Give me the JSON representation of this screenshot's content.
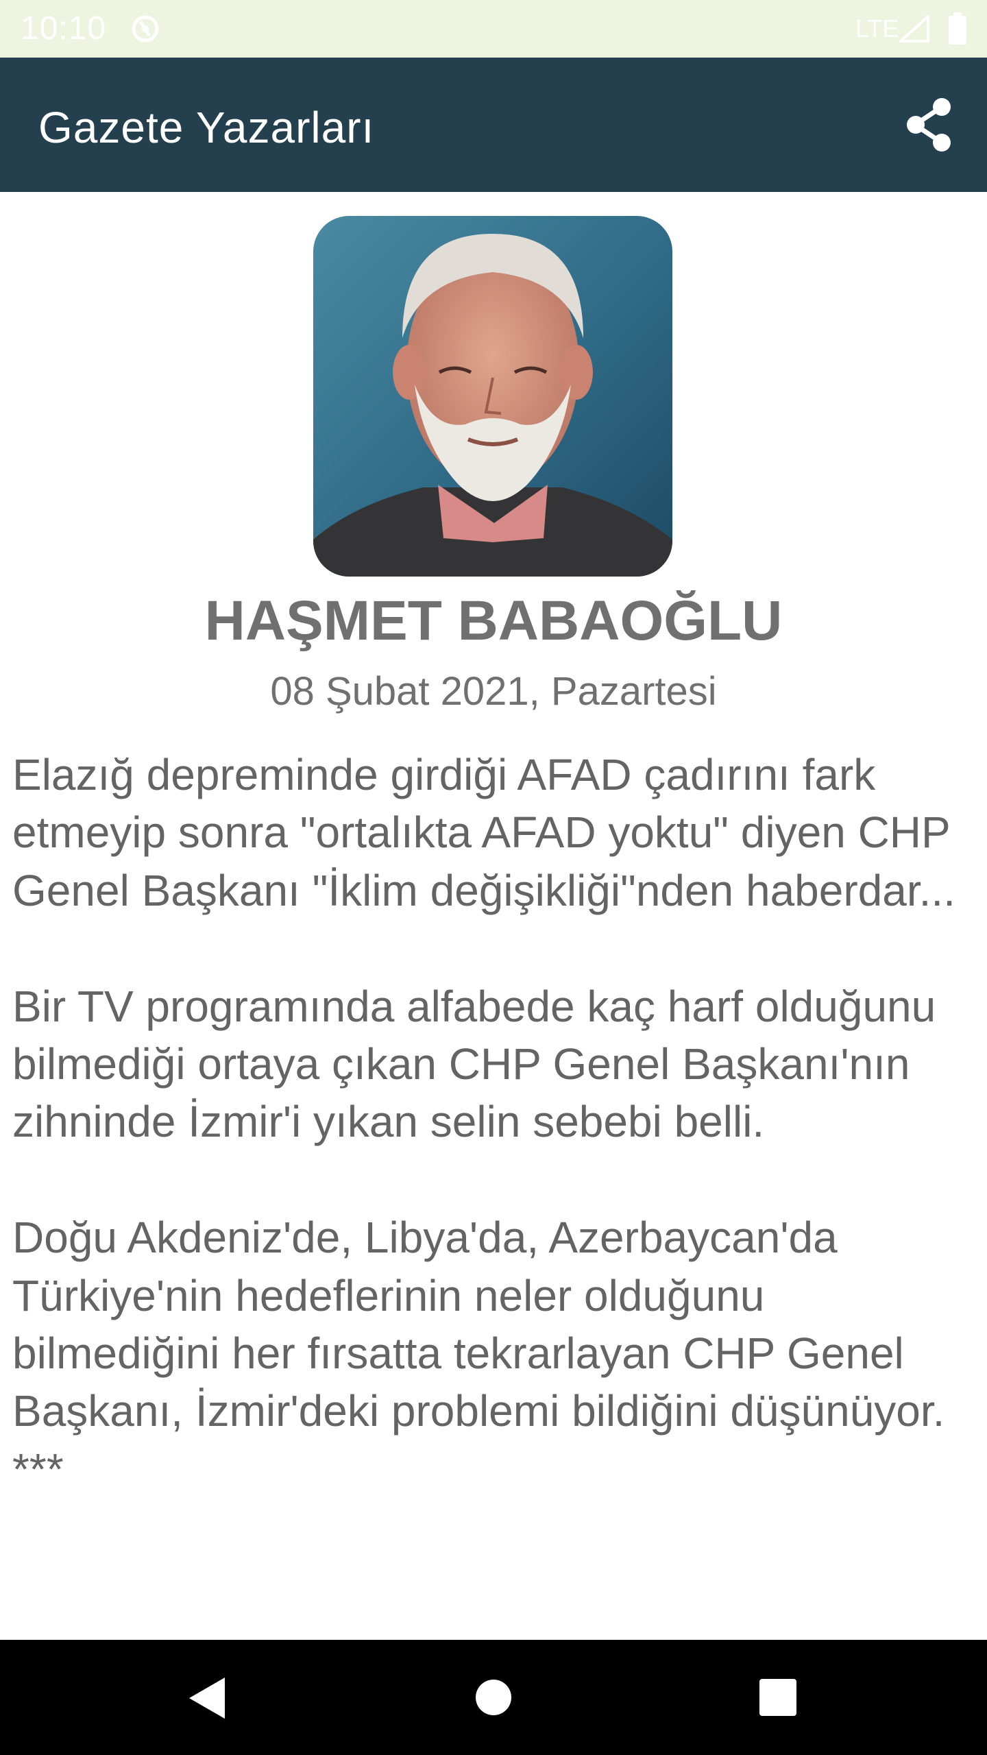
{
  "status_bar": {
    "time": "10:10",
    "network": "LTE",
    "sync_icon": "sync-icon",
    "signal_icon": "signal-icon",
    "battery_icon": "battery-icon"
  },
  "app_bar": {
    "title": "Gazete Yazarları",
    "share_icon": "share-icon"
  },
  "article": {
    "author_name": "HAŞMET BABAOĞLU",
    "date": "08 Şubat 2021, Pazartesi",
    "body": "Elazığ depreminde girdiği AFAD çadırını fark etmeyip sonra \"ortalıkta AFAD yoktu\" diyen CHP Genel Başkanı \"İklim değişikliği\"nden haberdar...\n\n Bir TV programında alfabede kaç harf olduğunu bilmediği ortaya çıkan CHP Genel Başkanı'nın zihninde İzmir'i yıkan selin sebebi belli.\n\n Doğu Akdeniz'de, Libya'da, Azerbaycan'da Türkiye'nin hedeflerinin neler olduğunu bilmediğini her fırsatta tekrarlayan CHP Genel Başkanı, İzmir'deki problemi bildiğini düşünüyor.\n***"
  },
  "nav_bar": {
    "back_icon": "back-icon",
    "home_icon": "home-icon",
    "recents_icon": "recents-icon"
  },
  "colors": {
    "status_bar_bg": "#eef4df",
    "app_bar_bg": "#243f4d",
    "text_gray": "#646464",
    "nav_bar_bg": "#000000"
  }
}
